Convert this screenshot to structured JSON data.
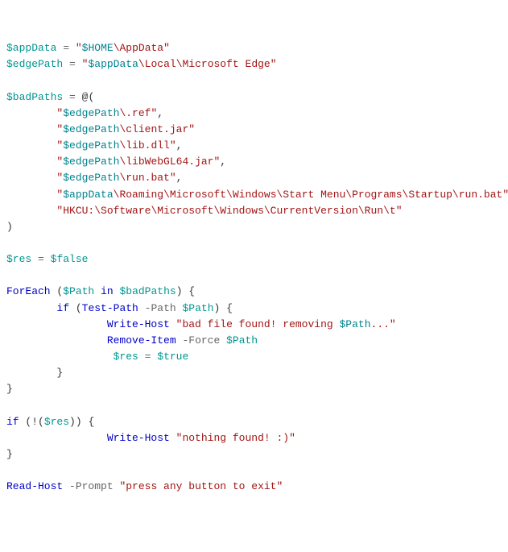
{
  "lines": [
    {
      "indent": "",
      "tokens": [
        {
          "c": "v",
          "t": "$appData"
        },
        {
          "c": "p",
          "t": " "
        },
        {
          "c": "op",
          "t": "="
        },
        {
          "c": "p",
          "t": " "
        },
        {
          "c": "s",
          "t": "\""
        },
        {
          "c": "sv",
          "t": "$HOME"
        },
        {
          "c": "s",
          "t": "\\AppData\""
        }
      ]
    },
    {
      "indent": "",
      "tokens": [
        {
          "c": "v",
          "t": "$edgePath"
        },
        {
          "c": "p",
          "t": " "
        },
        {
          "c": "op",
          "t": "="
        },
        {
          "c": "p",
          "t": " "
        },
        {
          "c": "s",
          "t": "\""
        },
        {
          "c": "sv",
          "t": "$appData"
        },
        {
          "c": "s",
          "t": "\\Local\\Microsoft Edge\""
        }
      ]
    },
    {
      "indent": "",
      "tokens": []
    },
    {
      "indent": "",
      "tokens": [
        {
          "c": "v",
          "t": "$badPaths"
        },
        {
          "c": "p",
          "t": " "
        },
        {
          "c": "op",
          "t": "="
        },
        {
          "c": "p",
          "t": " @("
        }
      ]
    },
    {
      "indent": "        ",
      "tokens": [
        {
          "c": "s",
          "t": "\""
        },
        {
          "c": "sv",
          "t": "$edgePath"
        },
        {
          "c": "s",
          "t": "\\.ref\""
        },
        {
          "c": "p",
          "t": ","
        }
      ]
    },
    {
      "indent": "        ",
      "tokens": [
        {
          "c": "s",
          "t": "\""
        },
        {
          "c": "sv",
          "t": "$edgePath"
        },
        {
          "c": "s",
          "t": "\\client.jar\""
        }
      ]
    },
    {
      "indent": "        ",
      "tokens": [
        {
          "c": "s",
          "t": "\""
        },
        {
          "c": "sv",
          "t": "$edgePath"
        },
        {
          "c": "s",
          "t": "\\lib.dll\""
        },
        {
          "c": "p",
          "t": ","
        }
      ]
    },
    {
      "indent": "        ",
      "tokens": [
        {
          "c": "s",
          "t": "\""
        },
        {
          "c": "sv",
          "t": "$edgePath"
        },
        {
          "c": "s",
          "t": "\\libWebGL64.jar\""
        },
        {
          "c": "p",
          "t": ","
        }
      ]
    },
    {
      "indent": "        ",
      "tokens": [
        {
          "c": "s",
          "t": "\""
        },
        {
          "c": "sv",
          "t": "$edgePath"
        },
        {
          "c": "s",
          "t": "\\run.bat\""
        },
        {
          "c": "p",
          "t": ","
        }
      ]
    },
    {
      "indent": "        ",
      "tokens": [
        {
          "c": "s",
          "t": "\""
        },
        {
          "c": "sv",
          "t": "$appData"
        },
        {
          "c": "s",
          "t": "\\Roaming\\Microsoft\\Windows\\Start Menu\\Programs\\Startup\\run.bat\""
        },
        {
          "c": "p",
          "t": ","
        }
      ]
    },
    {
      "indent": "        ",
      "tokens": [
        {
          "c": "s",
          "t": "\"HKCU:\\Software\\Microsoft\\Windows\\CurrentVersion\\Run\\t\""
        }
      ]
    },
    {
      "indent": "",
      "tokens": [
        {
          "c": "p",
          "t": ")"
        }
      ]
    },
    {
      "indent": "",
      "tokens": []
    },
    {
      "indent": "",
      "tokens": [
        {
          "c": "v",
          "t": "$res"
        },
        {
          "c": "p",
          "t": " "
        },
        {
          "c": "op",
          "t": "="
        },
        {
          "c": "p",
          "t": " "
        },
        {
          "c": "lit",
          "t": "$false"
        }
      ]
    },
    {
      "indent": "",
      "tokens": []
    },
    {
      "indent": "",
      "tokens": [
        {
          "c": "kw",
          "t": "ForEach"
        },
        {
          "c": "p",
          "t": " ("
        },
        {
          "c": "v",
          "t": "$Path"
        },
        {
          "c": "p",
          "t": " "
        },
        {
          "c": "kw",
          "t": "in"
        },
        {
          "c": "p",
          "t": " "
        },
        {
          "c": "v",
          "t": "$badPaths"
        },
        {
          "c": "p",
          "t": ") {"
        }
      ]
    },
    {
      "indent": "        ",
      "tokens": [
        {
          "c": "kw",
          "t": "if"
        },
        {
          "c": "p",
          "t": " ("
        },
        {
          "c": "kw",
          "t": "Test-Path"
        },
        {
          "c": "p",
          "t": " "
        },
        {
          "c": "op",
          "t": "-Path"
        },
        {
          "c": "p",
          "t": " "
        },
        {
          "c": "v",
          "t": "$Path"
        },
        {
          "c": "p",
          "t": ") {"
        }
      ]
    },
    {
      "indent": "                ",
      "tokens": [
        {
          "c": "kw",
          "t": "Write-Host"
        },
        {
          "c": "p",
          "t": " "
        },
        {
          "c": "s",
          "t": "\"bad file found! removing "
        },
        {
          "c": "sv",
          "t": "$Path"
        },
        {
          "c": "s",
          "t": "...\""
        }
      ]
    },
    {
      "indent": "                ",
      "tokens": [
        {
          "c": "kw",
          "t": "Remove-Item"
        },
        {
          "c": "p",
          "t": " "
        },
        {
          "c": "op",
          "t": "-Force"
        },
        {
          "c": "p",
          "t": " "
        },
        {
          "c": "v",
          "t": "$Path"
        }
      ]
    },
    {
      "indent": "                 ",
      "tokens": [
        {
          "c": "v",
          "t": "$res"
        },
        {
          "c": "p",
          "t": " "
        },
        {
          "c": "op",
          "t": "="
        },
        {
          "c": "p",
          "t": " "
        },
        {
          "c": "lit",
          "t": "$true"
        }
      ]
    },
    {
      "indent": "        ",
      "tokens": [
        {
          "c": "p",
          "t": "}"
        }
      ]
    },
    {
      "indent": "",
      "tokens": [
        {
          "c": "p",
          "t": "}"
        }
      ]
    },
    {
      "indent": "",
      "tokens": []
    },
    {
      "indent": "",
      "tokens": [
        {
          "c": "kw",
          "t": "if"
        },
        {
          "c": "p",
          "t": " (!("
        },
        {
          "c": "v",
          "t": "$res"
        },
        {
          "c": "p",
          "t": ")) {"
        }
      ]
    },
    {
      "indent": "                ",
      "tokens": [
        {
          "c": "kw",
          "t": "Write-Host"
        },
        {
          "c": "p",
          "t": " "
        },
        {
          "c": "s",
          "t": "\"nothing found! :)\""
        }
      ]
    },
    {
      "indent": "",
      "tokens": [
        {
          "c": "p",
          "t": "}"
        }
      ]
    },
    {
      "indent": "",
      "tokens": []
    },
    {
      "indent": "",
      "tokens": [
        {
          "c": "kw",
          "t": "Read-Host"
        },
        {
          "c": "p",
          "t": " "
        },
        {
          "c": "op",
          "t": "-Prompt"
        },
        {
          "c": "p",
          "t": " "
        },
        {
          "c": "s",
          "t": "\"press any button to exit\""
        }
      ]
    }
  ]
}
